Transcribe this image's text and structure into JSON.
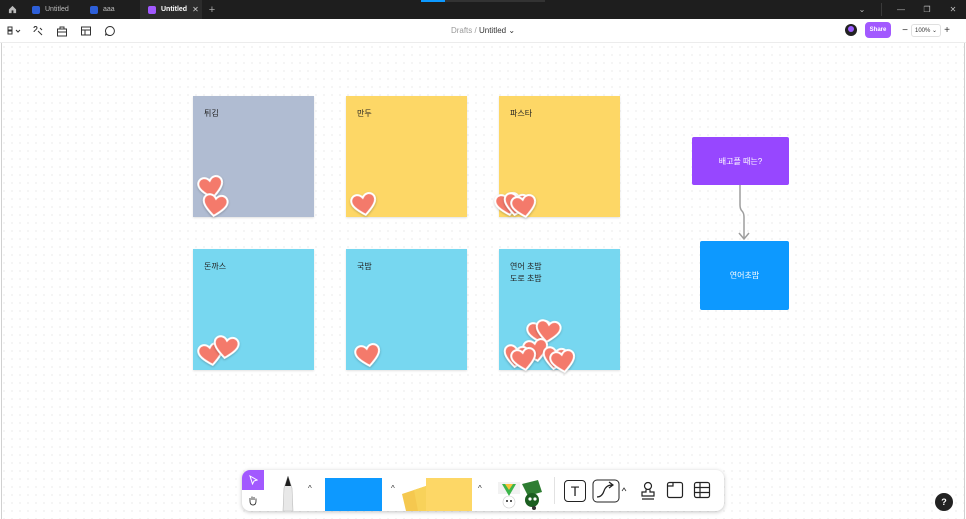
{
  "tabs": [
    {
      "label": "Untitled",
      "active": false
    },
    {
      "label": "aaa",
      "active": false
    },
    {
      "label": "Untitled",
      "active": true
    }
  ],
  "breadcrumb": {
    "project": "Drafts",
    "separator": "/",
    "title": "Untitled"
  },
  "toolbar": {
    "share_label": "Share",
    "zoom_label": "100%",
    "zoom_out": "−",
    "zoom_in": "+"
  },
  "stickies": [
    {
      "label": "튀김",
      "color": "#b0bcd2",
      "hearts": 2
    },
    {
      "label": "만두",
      "color": "#fdd766",
      "hearts": 1
    },
    {
      "label": "파스타",
      "color": "#fdd766",
      "hearts": 3
    },
    {
      "label": "돈까스",
      "color": "#77d7f0",
      "hearts": 2
    },
    {
      "label": "국밥",
      "color": "#77d7f0",
      "hearts": 1
    },
    {
      "label": "연어 초밥\n도로 초밥",
      "color": "#77d7f0",
      "hearts": 7
    }
  ],
  "flowchart": {
    "top": {
      "label": "배고플 때는?",
      "color": "#9747ff"
    },
    "bottom": {
      "label": "연어초밥",
      "color": "#0d99ff"
    }
  },
  "colors": {
    "heart": "#f47a6b",
    "accent": "#a259ff",
    "sticky_blue": "#0d99ff",
    "sticky_yellow": "#fdd766"
  },
  "help_label": "?"
}
